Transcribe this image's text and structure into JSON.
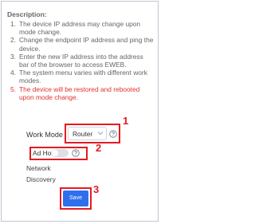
{
  "description": {
    "title": "Description:",
    "items": [
      {
        "num": "1.",
        "text": "The device IP address may change upon mode change."
      },
      {
        "num": "2.",
        "text": "Change the endpoint IP address and ping the device."
      },
      {
        "num": "3.",
        "text": "Enter the new IP address into the address bar of the browser to access EWEB."
      },
      {
        "num": "4.",
        "text": "The system menu varies with different work modes."
      },
      {
        "num": "5.",
        "text": "The device will be restored and rebooted upon mode change."
      }
    ]
  },
  "form": {
    "work_mode_label": "Work Mode",
    "work_mode_value": "Router",
    "ad_hoc_label": "Ad Hoc",
    "ad_hoc_enabled": false,
    "network_discovery_line1": "Network",
    "network_discovery_line2": "Discovery",
    "save_label": "Save"
  },
  "annotations": {
    "marker_1": "1",
    "marker_2": "2",
    "marker_3": "3"
  },
  "colors": {
    "highlight": "#e31b23",
    "primary_button": "#2f6fed",
    "warning_text": "#e0312f"
  },
  "icons": {
    "select_arrow": "chevron-down-icon",
    "help": "help-icon"
  }
}
